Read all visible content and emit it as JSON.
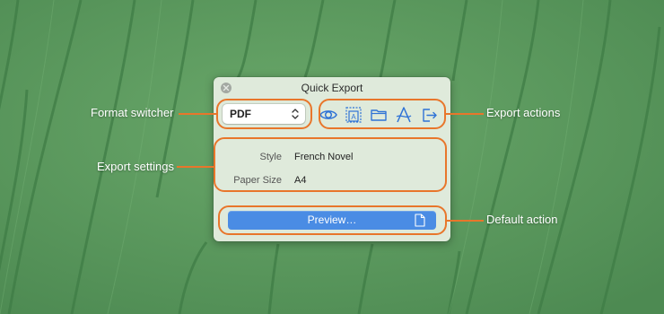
{
  "panel": {
    "title": "Quick Export",
    "close_icon": "close-icon",
    "format": {
      "value": "PDF",
      "arrows_icon": "up-down-chevron-icon"
    },
    "actions": [
      {
        "name": "preview-eye-icon"
      },
      {
        "name": "text-frame-icon"
      },
      {
        "name": "folder-icon"
      },
      {
        "name": "font-icon"
      },
      {
        "name": "share-icon"
      }
    ],
    "settings": [
      {
        "label": "Style",
        "value": "French Novel"
      },
      {
        "label": "Paper Size",
        "value": "A4"
      }
    ],
    "preview_button": {
      "label": "Preview…",
      "icon": "document-icon"
    }
  },
  "callouts": {
    "format_switcher": "Format switcher",
    "export_settings": "Export settings",
    "export_actions": "Export actions",
    "default_action": "Default action"
  },
  "colors": {
    "accent": "#4a8ce4",
    "icon_blue": "#2f73d6",
    "callout_orange": "#e8762b",
    "panel_bg": "#dfeadb",
    "leaf_green": "#5c9a5c"
  }
}
